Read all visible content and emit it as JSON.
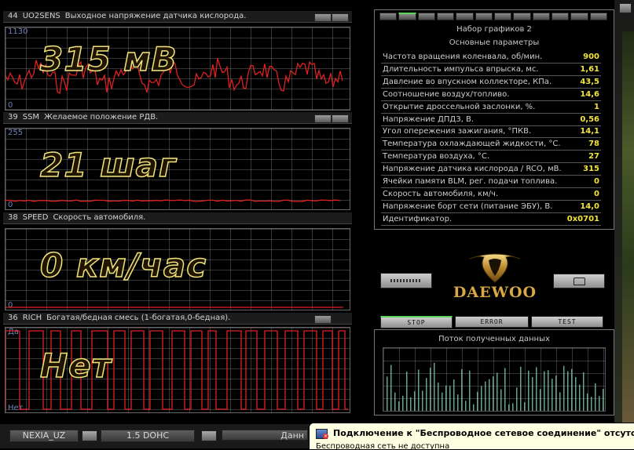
{
  "graphs": [
    {
      "num": "44",
      "code": "UO2SENS",
      "desc": "Выходное напряжение датчика кислорода.",
      "ymax": "1130",
      "ymin": "0",
      "value": "315 мВ"
    },
    {
      "num": "39",
      "code": "SSM",
      "desc": "Желаемое положение РДВ.",
      "ymax": "255",
      "ymin": "0",
      "value": "21 шаг"
    },
    {
      "num": "38",
      "code": "SPEED",
      "desc": "Скорость автомобиля.",
      "ymax": "",
      "ymin": "0",
      "value": "0 км/час"
    },
    {
      "num": "36",
      "code": "RICH",
      "desc": "Богатая/бедная смесь (1-богатая,0-бедная).",
      "ymax": "Да",
      "ymin": "Нет",
      "value": "Нет"
    }
  ],
  "graph_set_title": "Набор графиков 2",
  "params_title": "Основные параметры",
  "params": [
    {
      "label": "Частота вращения коленвала, об/мин.",
      "value": "900"
    },
    {
      "label": "Длительность импульса впрыска, мс.",
      "value": "1,61"
    },
    {
      "label": "Давление во впускном коллекторе, КПа.",
      "value": "43,5"
    },
    {
      "label": "Соотношение воздух/топливо.",
      "value": "14,6"
    },
    {
      "label": "Открытие дроссельной заслонки, %.",
      "value": "1"
    },
    {
      "label": "Напряжение ДПДЗ, В.",
      "value": "0,56"
    },
    {
      "label": "Угол опережения зажигания, °ПКВ.",
      "value": "14,1"
    },
    {
      "label": "Температура охлаждающей жидкости, °С.",
      "value": "78"
    },
    {
      "label": "Температура воздуха, °С.",
      "value": "27"
    },
    {
      "label": "Напряжение датчика кислорода / RCO, мВ.",
      "value": "315"
    },
    {
      "label": "Ячейки памяти BLM, рег. подачи топлива.",
      "value": "0"
    },
    {
      "label": "Скорость автомобиля, км/ч.",
      "value": "0"
    },
    {
      "label": "Напряжение борт сети (питание ЭБУ), В.",
      "value": "14,0"
    },
    {
      "label": "Идентификатор.",
      "value": "0x0701"
    }
  ],
  "logo_text": "DAEWOO",
  "buttons": {
    "stop": "STOP",
    "error": "ERROR",
    "test": "TEST"
  },
  "stream_title": "Поток полученных данных",
  "status": {
    "car": "NEXIA_UZ",
    "engine": "1.5 DOHC",
    "data_prefix": "Данн"
  },
  "notification": {
    "title": "Подключение к \"Беспроводное сетевое соединение\" отсутств",
    "body": "Беспроводная сеть не доступна"
  },
  "colors": {
    "trace": "#e02020",
    "value_text": "#f2e43a",
    "value_outline": "#f0e27a"
  }
}
